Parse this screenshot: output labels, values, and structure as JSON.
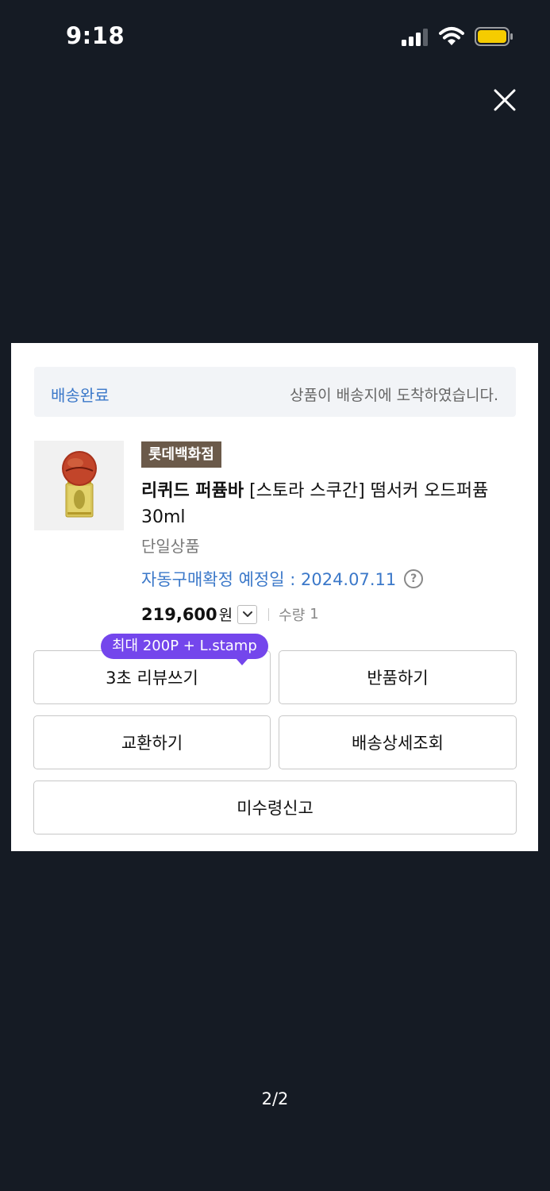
{
  "status_bar": {
    "time": "9:18"
  },
  "viewer": {
    "close_icon": "close-icon",
    "page_indicator": "2/2"
  },
  "order": {
    "delivery_status": "배송완료",
    "delivery_message": "상품이 배송지에 도착하였습니다.",
    "store_badge": "롯데백화점",
    "product_brand": "리퀴드 퍼퓸바",
    "product_title": " [스토라 스쿠간] 떰서커 오드퍼퓸 30ml",
    "option": "단일상품",
    "auto_confirm": "자동구매확정 예정일 : 2024.07.11",
    "help_icon": "question-circle-icon",
    "price": "219,600",
    "currency": "원",
    "quantity_label": "수량",
    "quantity": "1"
  },
  "actions": {
    "review_tip": "최대 200P + L.stamp",
    "review": "3초 리뷰쓰기",
    "return": "반품하기",
    "exchange": "교환하기",
    "tracking": "배송상세조회",
    "not_received": "미수령신고"
  },
  "colors": {
    "background": "#151b24",
    "accent_blue": "#3b78c9",
    "badge_brown": "#6b5a4a",
    "tip_purple": "#7446ec",
    "battery_yellow": "#f5cc00"
  }
}
